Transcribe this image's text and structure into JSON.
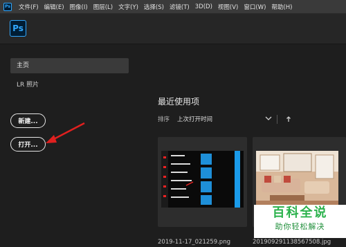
{
  "app": {
    "mini_logo": "Ps",
    "logo": "Ps"
  },
  "menu": [
    "文件(F)",
    "编辑(E)",
    "图像(I)",
    "图层(L)",
    "文字(Y)",
    "选择(S)",
    "滤镜(T)",
    "3D(D)",
    "视图(V)",
    "窗口(W)",
    "帮助(H)"
  ],
  "sidebar": {
    "home": "主页",
    "lr_photos": "LR 照片"
  },
  "buttons": {
    "new": "新建...",
    "open": "打开..."
  },
  "recent": {
    "title": "最近使用项",
    "sort_label": "排序",
    "sort_value": "上次打开时间",
    "files": [
      {
        "name": "2019-11-17_021259.png"
      },
      {
        "name": "20190929113856750​8.jpg"
      }
    ]
  },
  "annotation": {
    "arrow_color": "#e0201f"
  },
  "watermark": {
    "main": "百科全说",
    "sub": "助你轻松解决"
  },
  "colors": {
    "accent": "#31a8ff",
    "background": "#1e1e1e"
  }
}
